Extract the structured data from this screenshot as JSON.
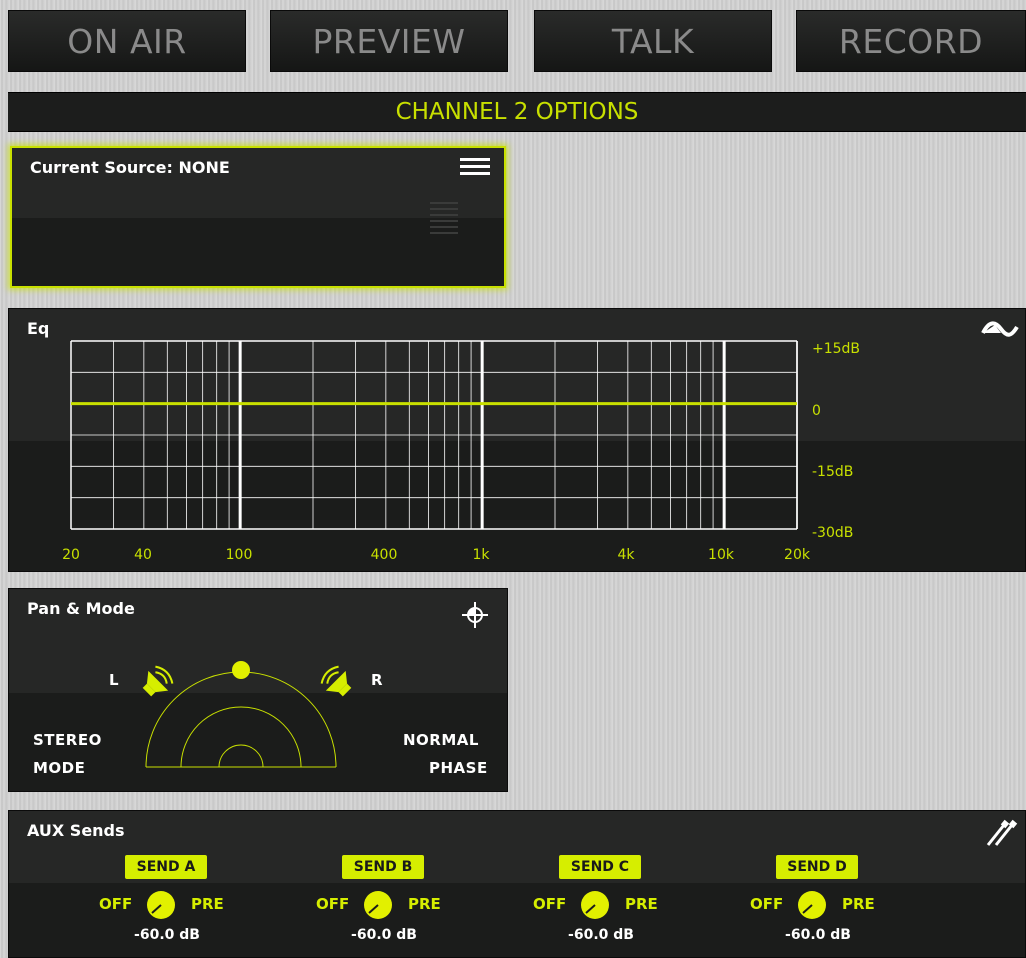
{
  "top_buttons": {
    "on_air": "ON AIR",
    "preview": "PREVIEW",
    "talk": "TALK",
    "record": "RECORD"
  },
  "title": "CHANNEL 2 OPTIONS",
  "accent_color": "#c8e000",
  "source": {
    "label": "Current Source: NONE",
    "menu_icon": "hamburger-menu-icon"
  },
  "eq": {
    "title": "Eq",
    "icon": "eq-curve-icon",
    "db_labels": [
      "+15dB",
      "0",
      "-15dB",
      "-30dB"
    ],
    "freq_labels": [
      "20",
      "40",
      "100",
      "400",
      "1k",
      "4k",
      "10k",
      "20k"
    ],
    "curve_gain_db": 0
  },
  "pan": {
    "title": "Pan & Mode",
    "icon": "crosshair-icon",
    "left_label": "L",
    "right_label": "R",
    "mode_line1": "STEREO",
    "mode_line2": "MODE",
    "phase_line1": "NORMAL",
    "phase_line2": "PHASE",
    "pan_position": 0
  },
  "aux": {
    "title": "AUX Sends",
    "icon": "plug-cable-icon",
    "sends": [
      {
        "label": "SEND A",
        "off": "OFF",
        "pre": "PRE",
        "value": "-60.0 dB"
      },
      {
        "label": "SEND B",
        "off": "OFF",
        "pre": "PRE",
        "value": "-60.0 dB"
      },
      {
        "label": "SEND C",
        "off": "OFF",
        "pre": "PRE",
        "value": "-60.0 dB"
      },
      {
        "label": "SEND D",
        "off": "OFF",
        "pre": "PRE",
        "value": "-60.0 dB"
      }
    ]
  }
}
